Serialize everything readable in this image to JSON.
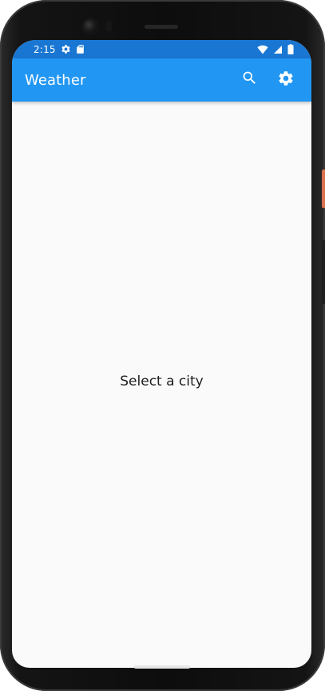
{
  "status_bar": {
    "time": "2:15",
    "left_icons": [
      "gear-icon",
      "sd-card-icon"
    ],
    "right_icons": [
      "wifi-icon",
      "cellular-signal-icon",
      "battery-icon"
    ],
    "color": "#1976d2"
  },
  "app_bar": {
    "title": "Weather",
    "color": "#2196f3",
    "actions": [
      {
        "icon": "search-icon"
      },
      {
        "icon": "settings-icon"
      }
    ]
  },
  "main": {
    "empty_message": "Select a city",
    "background": "#fafafa"
  }
}
